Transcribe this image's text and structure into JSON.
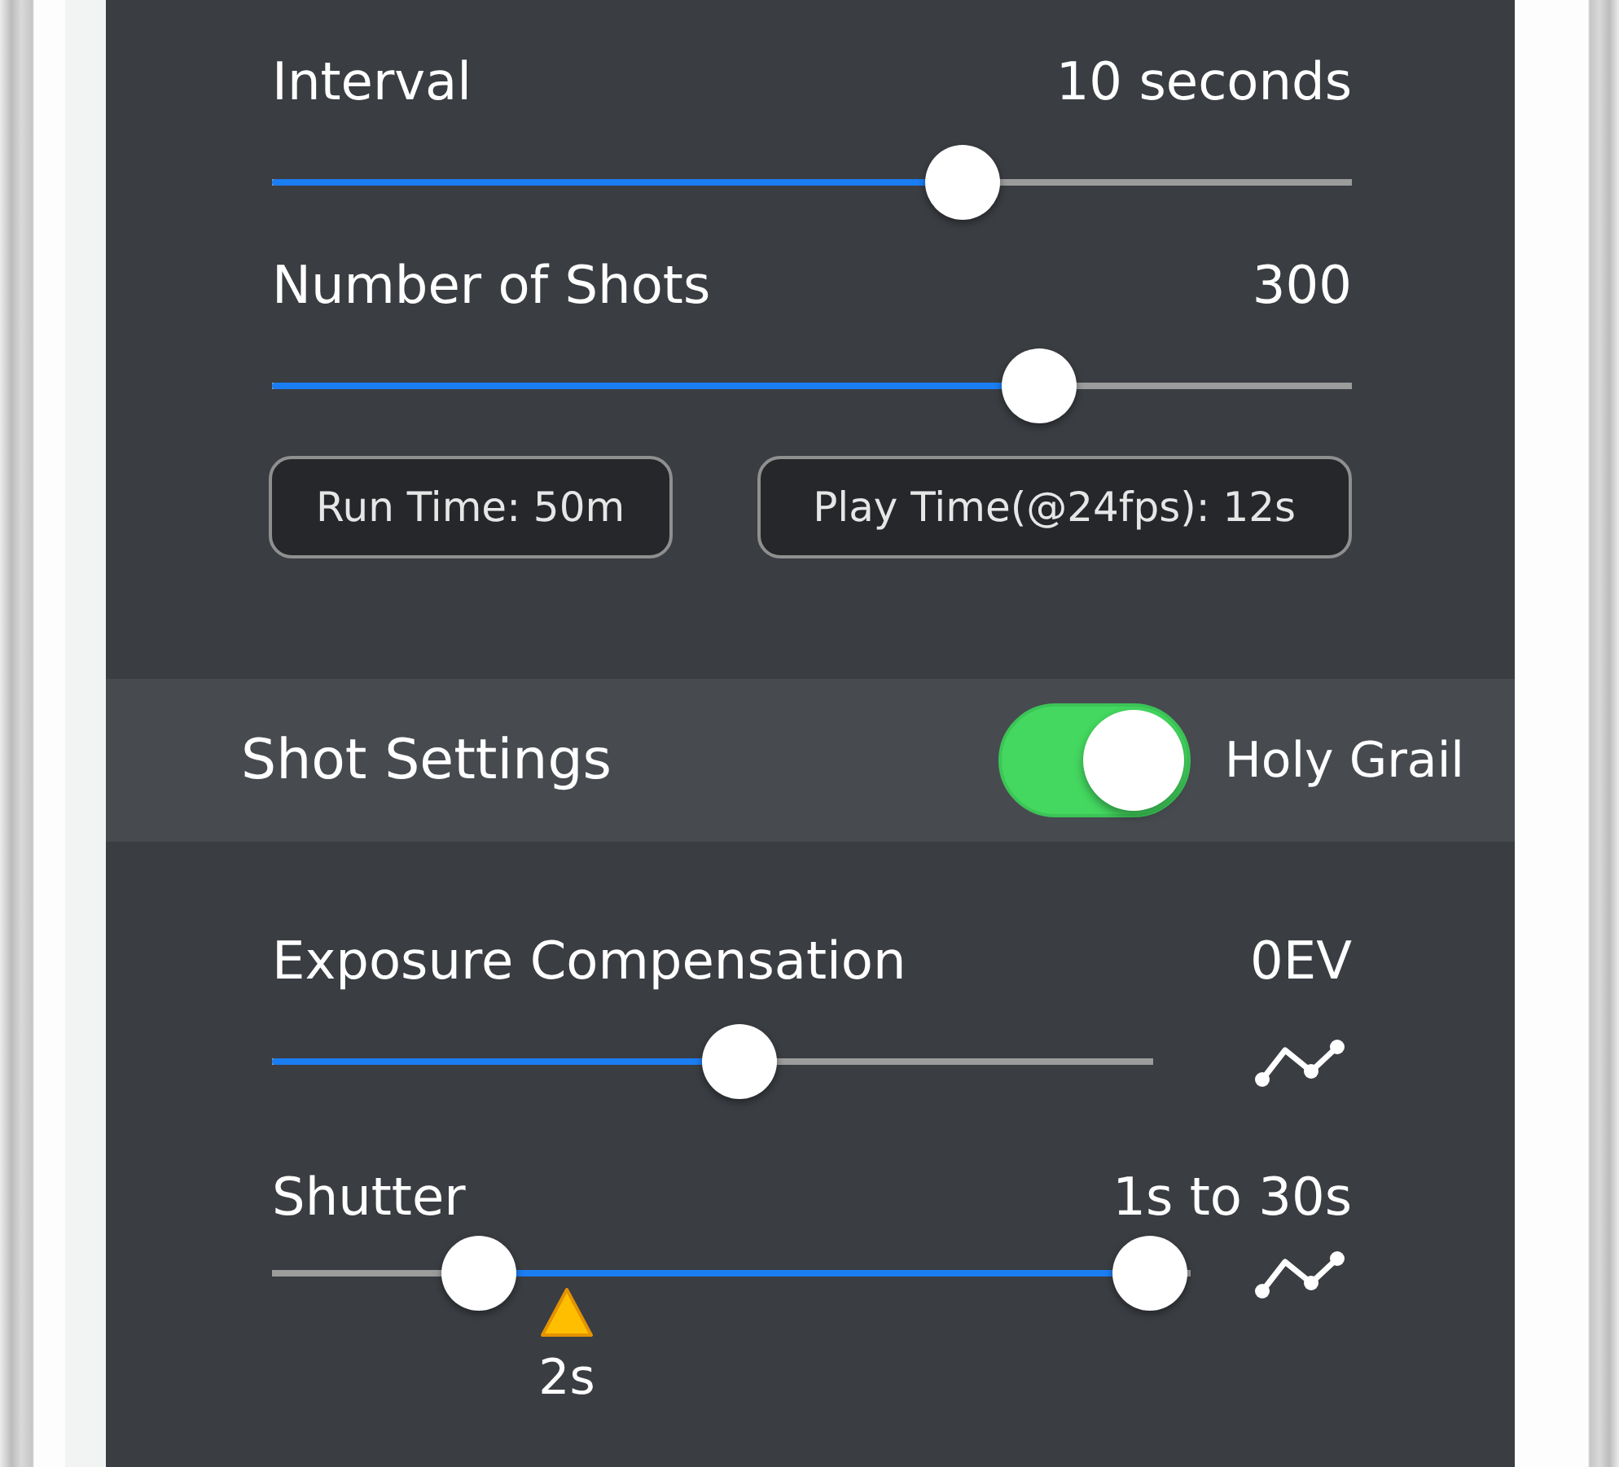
{
  "timelapse": {
    "sliders": [
      {
        "kind": "single",
        "label": "Interval",
        "value": "10 seconds",
        "level": 0.64
      },
      {
        "kind": "single",
        "label": "Number of Shots",
        "value": "300",
        "level": 0.71
      }
    ],
    "readouts": [
      "Run Time: 50m",
      "Play Time(@24fps): 12s"
    ]
  },
  "shot_settings": {
    "title": "Shot Settings",
    "toggle": {
      "label": "Holy Grail",
      "on": true
    },
    "sliders": [
      {
        "kind": "single",
        "label": "Exposure Compensation",
        "value": "0EV",
        "level": 0.53,
        "ramp_button": true
      },
      {
        "kind": "range",
        "label": "Shutter",
        "value": "1s to 30s",
        "thumbs": [
          {
            "level": 0.225
          },
          {
            "level": 0.956
          }
        ],
        "marker": {
          "label": "2s",
          "level": 0.321
        },
        "ramp_button": true
      }
    ]
  }
}
